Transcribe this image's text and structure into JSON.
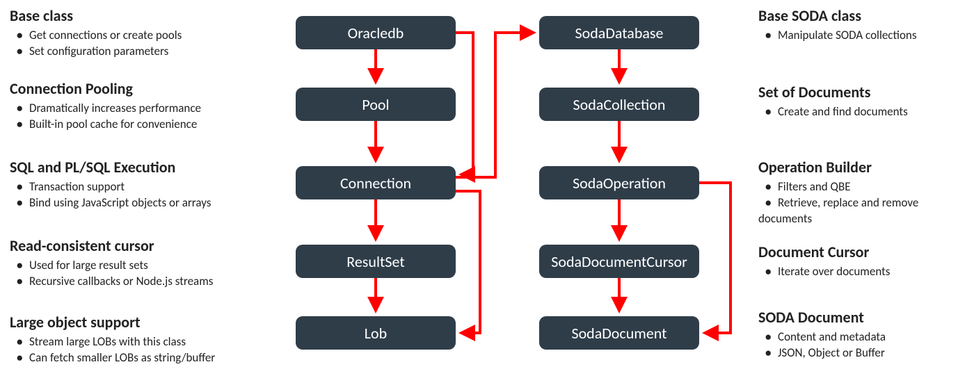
{
  "diagram": {
    "nodes": {
      "oracledb": "Oracledb",
      "pool": "Pool",
      "connection": "Connection",
      "resultset": "ResultSet",
      "lob": "Lob",
      "sodadatabase": "SodaDatabase",
      "sodacollection": "SodaCollection",
      "sodaoperation": "SodaOperation",
      "sodadocumentcursor": "SodaDocumentCursor",
      "sodadocument": "SodaDocument"
    }
  },
  "left": {
    "baseclass": {
      "heading": "Base class",
      "b1": "Get connections or create pools",
      "b2": "Set configuration parameters"
    },
    "pooling": {
      "heading": "Connection Pooling",
      "b1": "Dramatically increases performance",
      "b2": "Built-in pool cache for convenience"
    },
    "sql": {
      "heading": "SQL and PL/SQL Execution",
      "b1": "Transaction support",
      "b2": "Bind using JavaScript objects or arrays"
    },
    "cursor": {
      "heading": "Read-consistent cursor",
      "b1": "Used for large result sets",
      "b2": "Recursive callbacks or Node.js streams"
    },
    "lob": {
      "heading": "Large object support",
      "b1": "Stream large LOBs with this class",
      "b2": "Can fetch smaller LOBs as string/buffer"
    }
  },
  "right": {
    "basesoda": {
      "heading": "Base SODA class",
      "b1": "Manipulate SODA collections"
    },
    "setdocs": {
      "heading": "Set of Documents",
      "b1": "Create and find documents"
    },
    "opbuilder": {
      "heading": "Operation Builder",
      "b1": "Filters and QBE",
      "b2": "Retrieve, replace and remove documents"
    },
    "doccursor": {
      "heading": "Document Cursor",
      "b1": "Iterate over documents"
    },
    "sodadoc": {
      "heading": "SODA Document",
      "b1": "Content and metadata",
      "b2": "JSON, Object or Buffer"
    }
  }
}
